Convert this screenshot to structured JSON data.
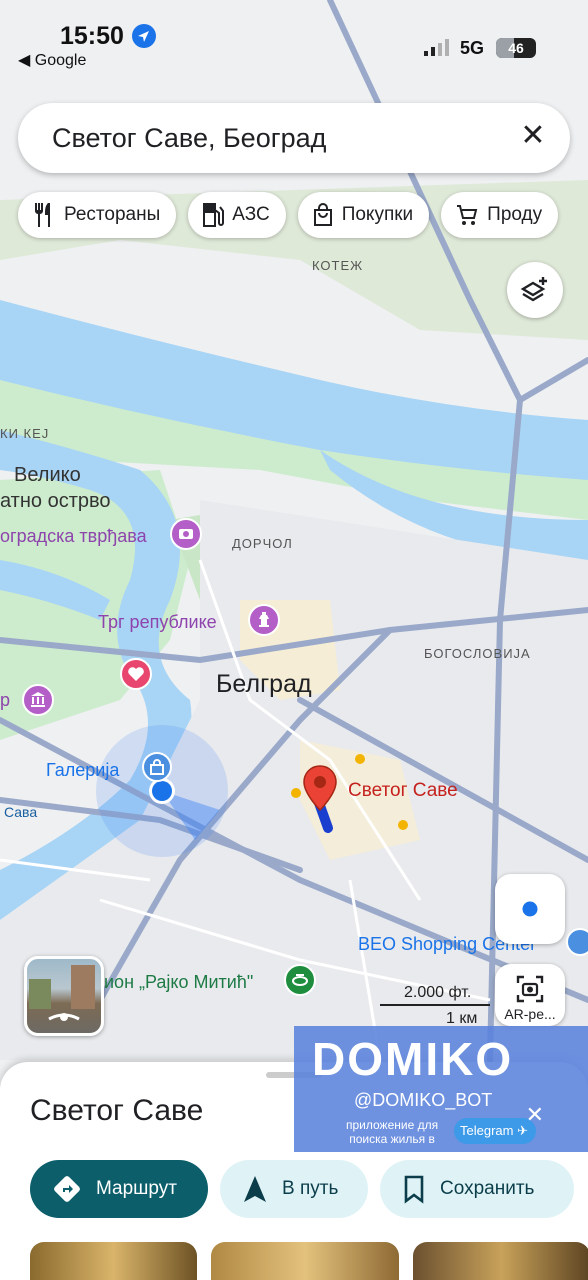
{
  "status_bar": {
    "time": "15:50",
    "back_app": "◀ Google",
    "network": "5G",
    "battery": "46",
    "battery_level": 0.46
  },
  "search": {
    "query": "Светог Саве, Београд"
  },
  "chips": [
    {
      "label": "Рестораны",
      "icon": "fork-knife-icon"
    },
    {
      "label": "АЗС",
      "icon": "gas-station-icon"
    },
    {
      "label": "Покупки",
      "icon": "shopping-bag-icon"
    },
    {
      "label": "Проду",
      "icon": "cart-icon"
    }
  ],
  "map_labels": {
    "kotezh": "КОТЕЖ",
    "kej": "КИ КЕЈ",
    "veliko": "Велико",
    "ostrvo": "атно острво",
    "tvrdjava": "оградска тврђава",
    "dorcol": "ДОРЧОЛ",
    "trg": "Трг републике",
    "bogoslovija": "БОГОСЛОВИЈА",
    "beograd": "Белград",
    "r_label": "р",
    "galerija": "Галерија",
    "sava": "Сава",
    "svetog_save": "Светог Саве",
    "beo": "BEO Shopping Center",
    "stadion": "ион „Рајко Митић\""
  },
  "scale": {
    "ft": "2.000 фт.",
    "km": "1 км"
  },
  "ar_button": {
    "label": "AR-ре..."
  },
  "banner": {
    "logo": "DOMIKO",
    "handle": "@DOMIKO_BOT",
    "sub1": "приложение для",
    "sub2": "поиска жилья в",
    "telegram": "Telegram"
  },
  "sheet": {
    "title": "Светог Саве",
    "actions": [
      {
        "label": "Маршрут",
        "icon": "directions-icon"
      },
      {
        "label": "В путь",
        "icon": "navigation-arrow-icon"
      },
      {
        "label": "Сохранить",
        "icon": "bookmark-icon"
      }
    ]
  },
  "colors": {
    "water": "#a8d4f5",
    "park": "#cdeccd",
    "road": "#9aa9c9",
    "accent": "#0b5e6a",
    "marker": "#ea4335"
  }
}
